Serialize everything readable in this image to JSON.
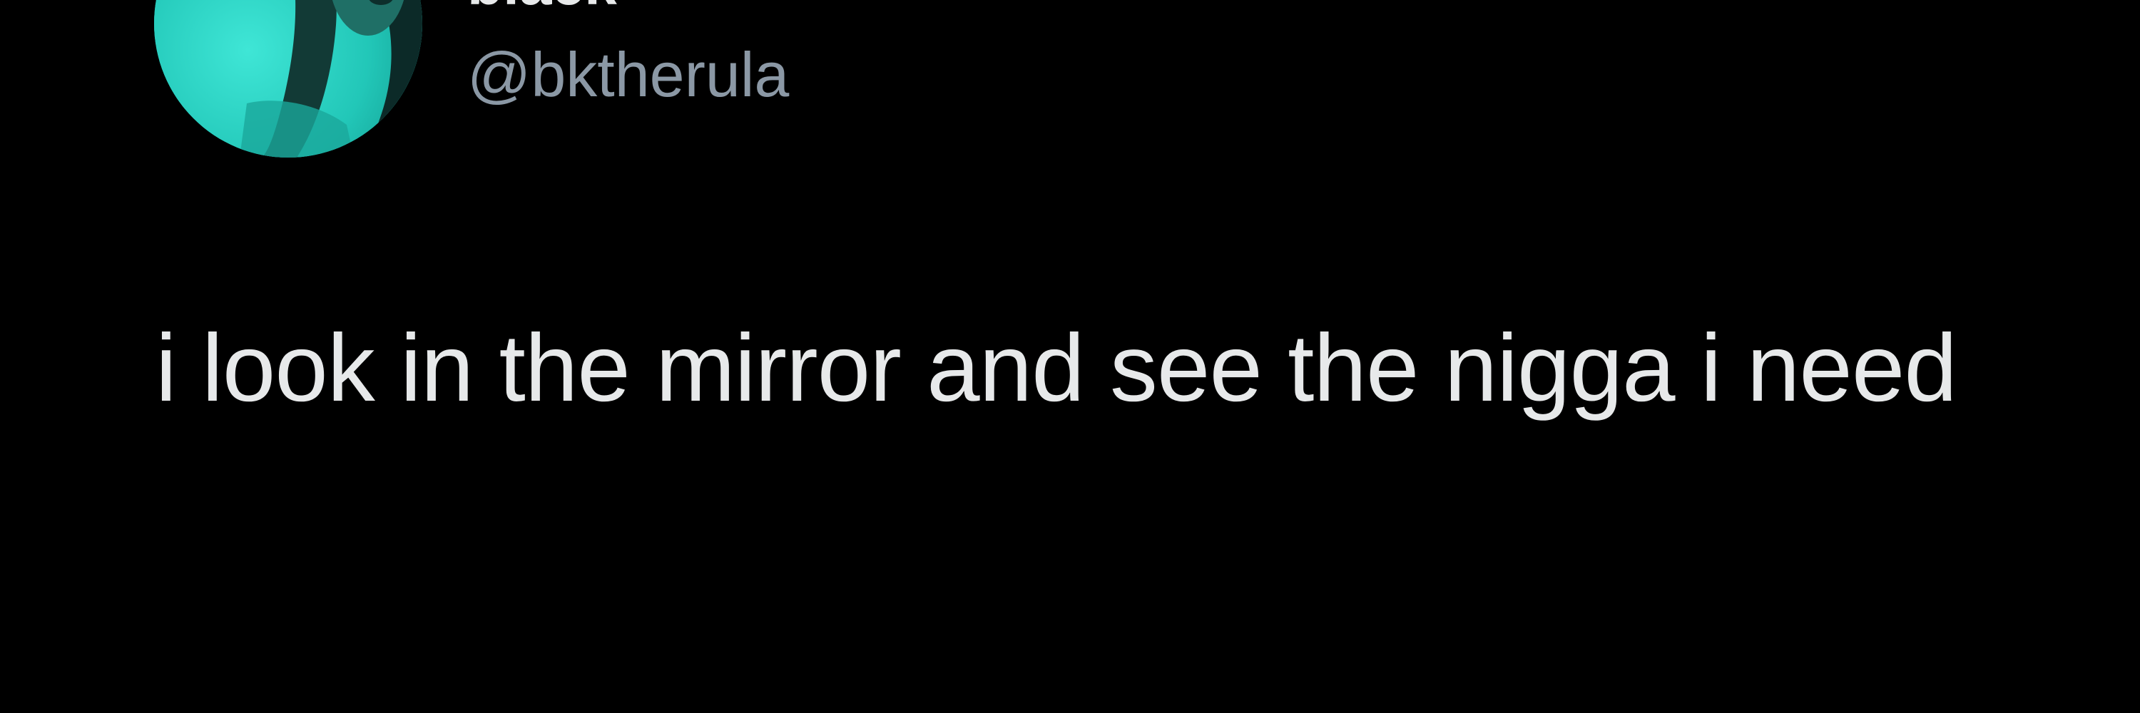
{
  "author": {
    "display_name": "black",
    "handle": "@bktherula",
    "avatar_icon": "profile-photo-avatar"
  },
  "tweet": {
    "text": "i look in the mirror and see the nigga i need"
  },
  "colors": {
    "background": "#000000",
    "text_primary": "#e7e9ea",
    "text_secondary": "#8b98a5",
    "avatar_accent": "#2ad1c2"
  }
}
